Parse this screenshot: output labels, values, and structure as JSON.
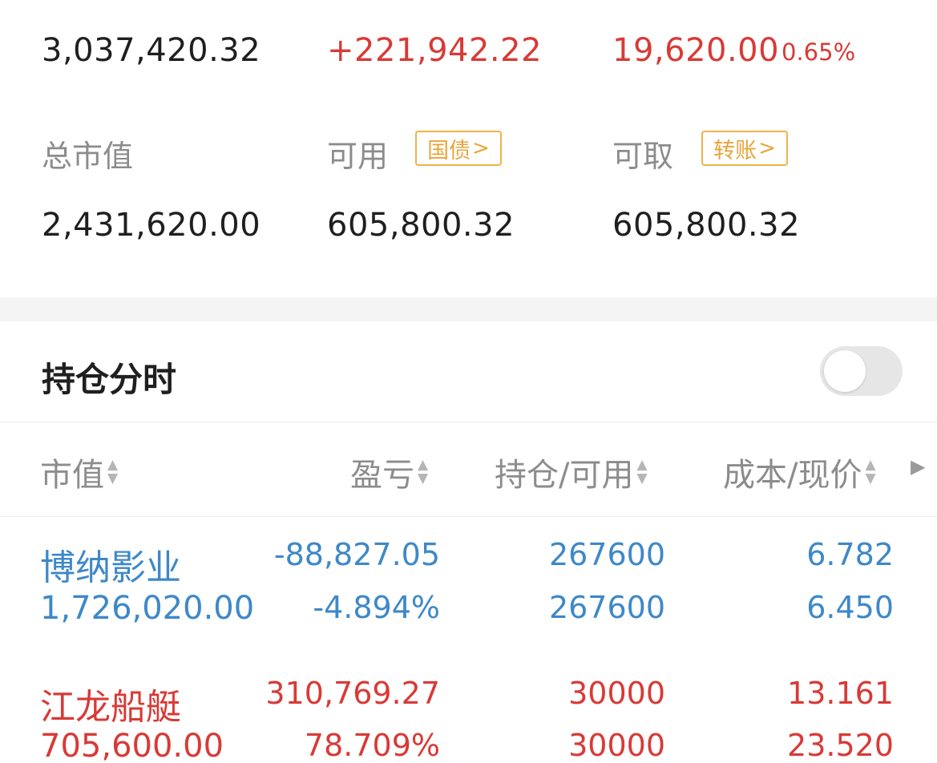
{
  "summary": {
    "total_assets": "3,037,420.32",
    "total_pnl": "+221,942.22",
    "today_pnl": "19,620.00",
    "today_pct": "0.65%",
    "market_value_label": "总市值",
    "available_label": "可用",
    "bond_tag": "国债",
    "withdrawable_label": "可取",
    "transfer_tag": "转账",
    "market_value": "2,431,620.00",
    "available": "605,800.32",
    "withdrawable": "605,800.32"
  },
  "positions_section": {
    "title": "持仓分时",
    "toggle_on": false
  },
  "table": {
    "headers": [
      "市值",
      "盈亏",
      "持仓/可用",
      "成本/现价"
    ],
    "rows": [
      {
        "name": "博纳影业",
        "market_value": "1,726,020.00",
        "pnl": "-88,827.05",
        "pnl_pct": "-4.894%",
        "position": "267600",
        "available": "267600",
        "cost": "6.782",
        "price": "6.450",
        "color": "#3e88c8"
      },
      {
        "name": "江龙船艇",
        "market_value": "705,600.00",
        "pnl": "310,769.27",
        "pnl_pct": "78.709%",
        "position": "30000",
        "available": "30000",
        "cost": "13.161",
        "price": "23.520",
        "color": "#d83a36"
      }
    ]
  },
  "colors": {
    "gain": "#d83a36",
    "loss": "#3e88c8",
    "tag": "#f0b24a"
  }
}
